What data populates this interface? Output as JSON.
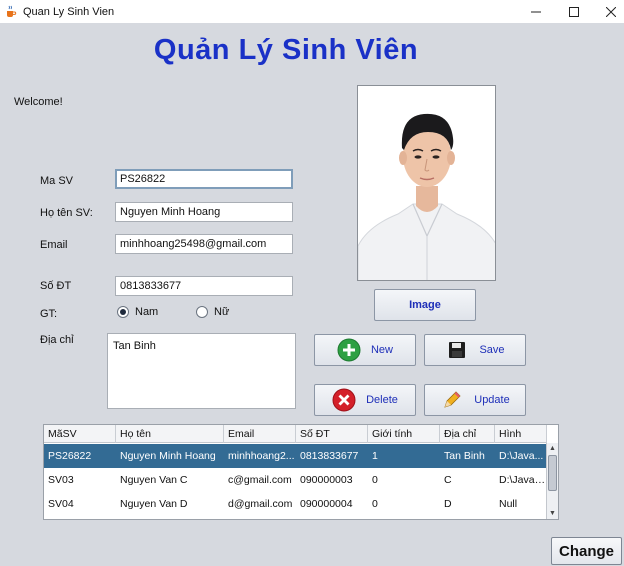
{
  "window": {
    "title": "Quan Ly Sinh Vien"
  },
  "heading": "Quản Lý Sinh Viên",
  "welcome": "Welcome!",
  "form": {
    "masv_label": "Ma SV",
    "masv_value": "PS26822",
    "hoten_label": "Họ tên SV:",
    "hoten_value": "Nguyen Minh Hoang",
    "email_label": "Email",
    "email_value": "minhhoang25498@gmail.com",
    "sodt_label": "Số ĐT",
    "sodt_value": "0813833677",
    "gt_label": "GT:",
    "gender_male": "Nam",
    "gender_female": "Nữ",
    "gender_selected": "Nam",
    "diachi_label": "Địa chỉ",
    "diachi_value": "Tan Binh"
  },
  "buttons": {
    "image": "Image",
    "new": "New",
    "save": "Save",
    "delete": "Delete",
    "update": "Update",
    "change": "Change"
  },
  "table": {
    "columns": [
      "MãSV",
      "Họ tên",
      "Email",
      "Số ĐT",
      "Giới tính",
      "Địa chỉ",
      "Hình"
    ],
    "rows": [
      [
        "PS26822",
        "Nguyen Minh Hoang",
        "minhhoang2...",
        "0813833677",
        "1",
        "Tan Binh",
        "D:\\Java..."
      ],
      [
        "SV03",
        "Nguyen Van C",
        "c@gmail.com",
        "090000003",
        "0",
        "C",
        "D:\\Java_..."
      ],
      [
        "SV04",
        "Nguyen Van D",
        "d@gmail.com",
        "090000004",
        "0",
        "D",
        "Null"
      ]
    ],
    "selected_row": 0
  },
  "colors": {
    "heading": "#1a31c7",
    "button_text": "#1e2fb8",
    "selection": "#336b94",
    "new_icon": "#2ea043",
    "delete_icon": "#d4202a"
  },
  "icons": {
    "app": "java-cup-icon",
    "new": "plus-circle-icon",
    "save": "floppy-disk-icon",
    "delete": "x-circle-icon",
    "update": "pencil-icon"
  }
}
